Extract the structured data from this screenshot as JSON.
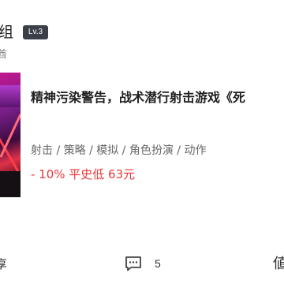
{
  "author": {
    "name": "组",
    "level": "Lv.3",
    "subline": "酋"
  },
  "game_card": {
    "title": "精神污染警告，战术潜行射击游戏《死",
    "tags": "射击 / 策略 / 模拟 / 角色扮演 / 动作",
    "price": "- 10% 平史低 63元"
  },
  "actions": {
    "share_label": "享",
    "comment_count": "5",
    "like_label": "値"
  },
  "colors": {
    "price": "#e8393a",
    "badge_bg": "#3a3f48"
  },
  "icons": [
    "comment-icon"
  ]
}
